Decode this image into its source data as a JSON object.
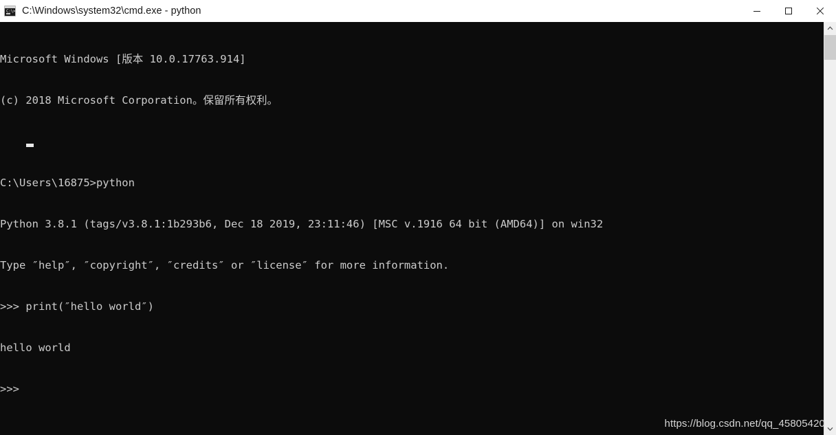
{
  "window": {
    "title": "C:\\Windows\\system32\\cmd.exe - python",
    "icon": "cmd-console-icon",
    "icon_glyph": "C:\\>",
    "background_color": "#0c0c0c",
    "titlebar_color": "#ffffff",
    "text_color": "#cccccc"
  },
  "window_controls": {
    "minimize": {
      "name": "minimize-button",
      "glyph": "—"
    },
    "maximize": {
      "name": "maximize-button",
      "glyph": "□"
    },
    "close": {
      "name": "close-button",
      "glyph": "✕"
    }
  },
  "console": {
    "lines": [
      "Microsoft Windows [版本 10.0.17763.914]",
      "(c) 2018 Microsoft Corporation。保留所有权利。",
      "",
      "C:\\Users\\16875>python",
      "Python 3.8.1 (tags/v3.8.1:1b293b6, Dec 18 2019, 23:11:46) [MSC v.1916 64 bit (AMD64)] on win32",
      "Type ″help″, ″copyright″, ″credits″ or ″license″ for more information.",
      ">>> print(″hello world″)",
      "hello world",
      ">>> "
    ],
    "prompt": ">>>",
    "cursor_visible": true
  },
  "scrollbar": {
    "up_arrow": "chevron-up-icon",
    "down_arrow": "chevron-down-icon",
    "thumb_position_percent": 3,
    "track_color": "#f0f0f0",
    "thumb_color": "#cdcdcd"
  },
  "watermark": {
    "text": "https://blog.csdn.net/qq_45805420"
  }
}
